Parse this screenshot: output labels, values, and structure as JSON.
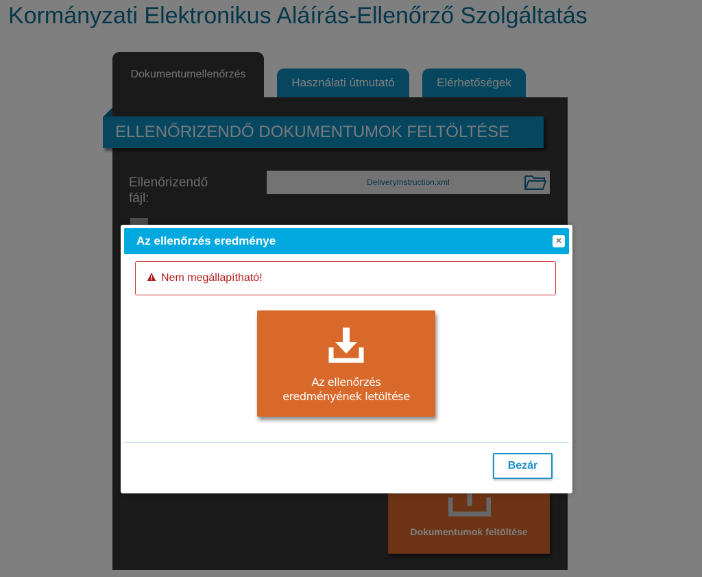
{
  "page": {
    "title": "Kormányzati Elektronikus Aláírás-Ellenőrző Szolgáltatás"
  },
  "tabs": [
    {
      "label": "Dokumentumellenőrzés",
      "active": true
    },
    {
      "label": "Használati útmutató",
      "active": false
    },
    {
      "label": "Elérhetőségek",
      "active": false
    }
  ],
  "upload_section": {
    "heading": "ELLENŐRIZENDŐ DOKUMENTUMOK FELTÖLTÉSE",
    "file_label": "Ellenőrizendő fájl:",
    "file_name": "DeliveryInstruction.xml",
    "file_icon": "folder-open-icon",
    "upload_button_label": "Dokumentumok feltöltése",
    "upload_icon": "upload-icon"
  },
  "modal": {
    "title": "Az ellenőrzés eredménye",
    "close_icon": "close-icon",
    "alert_text": "Nem megállapítható!",
    "alert_icon": "warning-icon",
    "download_label": "Az ellenőrzés eredményének letöltése",
    "download_icon": "download-icon",
    "close_button_label": "Bezár"
  },
  "colors": {
    "brand_blue": "#0d8fbf",
    "modal_header": "#00a8e0",
    "action_orange": "#d9692a",
    "alert_red": "#d33333",
    "panel_dark": "#353535"
  }
}
